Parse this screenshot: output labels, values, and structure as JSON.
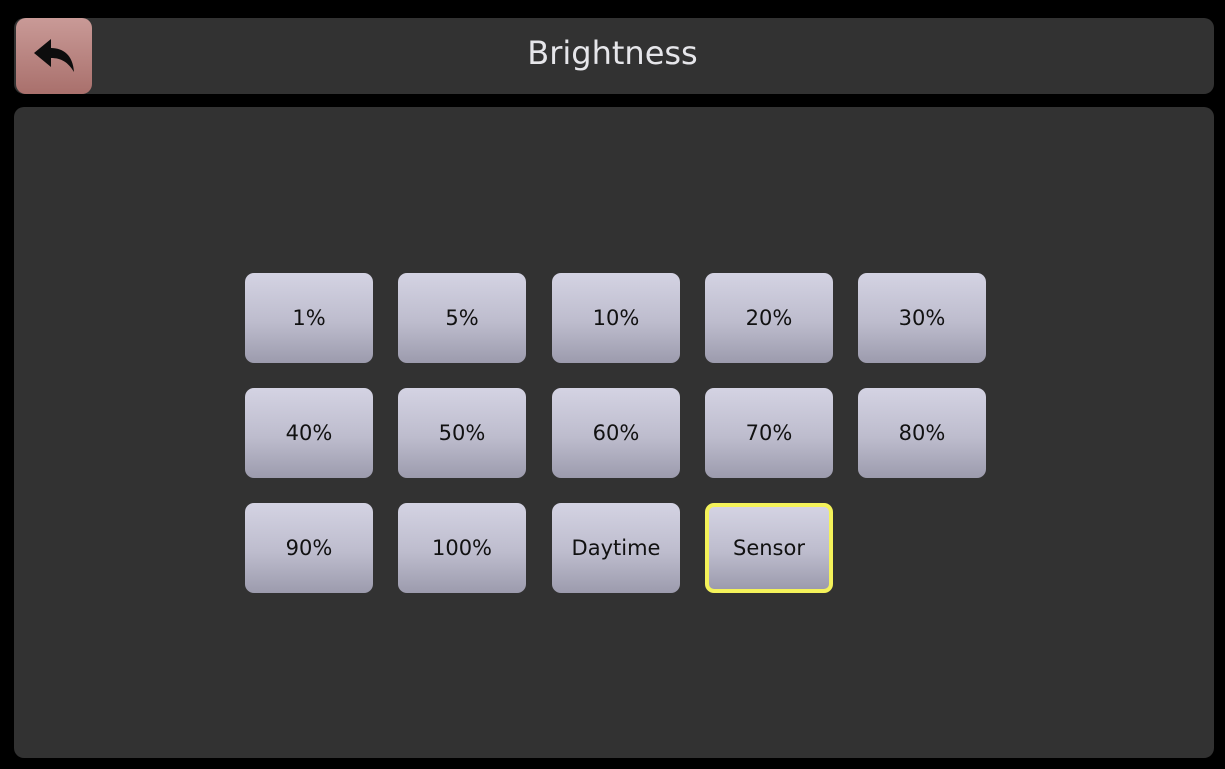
{
  "header": {
    "title": "Brightness",
    "back_icon": "back-arrow-icon"
  },
  "options": [
    {
      "label": "1%"
    },
    {
      "label": "5%"
    },
    {
      "label": "10%"
    },
    {
      "label": "20%"
    },
    {
      "label": "30%"
    },
    {
      "label": "40%"
    },
    {
      "label": "50%"
    },
    {
      "label": "60%"
    },
    {
      "label": "70%"
    },
    {
      "label": "80%"
    },
    {
      "label": "90%"
    },
    {
      "label": "100%"
    },
    {
      "label": "Daytime"
    },
    {
      "label": "Sensor",
      "selected": true
    }
  ],
  "colors": {
    "background": "#000000",
    "panel": "#323232",
    "button": "#bdbccd",
    "back_button": "#b7817d",
    "selection_highlight": "#f4f25a",
    "title_text": "#e6e6ea",
    "button_text": "#111111"
  }
}
